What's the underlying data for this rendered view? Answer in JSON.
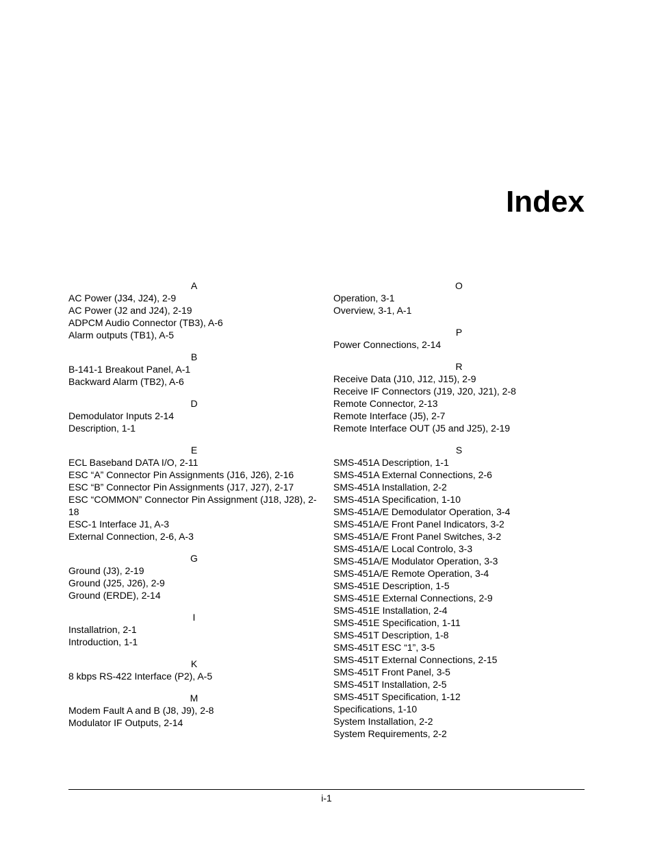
{
  "title": "Index",
  "page_label": "i-1",
  "columns": [
    {
      "groups": [
        {
          "letter": "A",
          "entries": [
            "AC Power (J34, J24), 2-9",
            "AC Power (J2 and J24), 2-19",
            "ADPCM Audio Connector (TB3), A-6",
            "Alarm outputs (TB1), A-5"
          ]
        },
        {
          "letter": "B",
          "entries": [
            "B-141-1 Breakout Panel, A-1",
            "Backward Alarm (TB2), A-6"
          ]
        },
        {
          "letter": "D",
          "entries": [
            "Demodulator Inputs 2-14",
            "Description, 1-1"
          ]
        },
        {
          "letter": "E",
          "entries": [
            "ECL Baseband DATA I/O, 2-11",
            "ESC “A” Connector Pin Assignments (J16, J26), 2-16",
            "ESC “B” Connector Pin Assignments (J17, J27), 2-17",
            "ESC “COMMON” Connector Pin Assignment (J18, J28), 2-18",
            "ESC-1 Interface J1, A-3",
            "External Connection, 2-6, A-3"
          ]
        },
        {
          "letter": "G",
          "entries": [
            "Ground (J3), 2-19",
            "Ground (J25, J26), 2-9",
            "Ground (ERDE), 2-14"
          ]
        },
        {
          "letter": "I",
          "entries": [
            "Installatrion, 2-1",
            "Introduction, 1-1"
          ]
        },
        {
          "letter": "K",
          "entries": [
            "8 kbps RS-422 Interface (P2), A-5"
          ]
        },
        {
          "letter": "M",
          "entries": [
            "Modem Fault A and B (J8, J9), 2-8",
            "Modulator IF Outputs, 2-14"
          ]
        }
      ]
    },
    {
      "groups": [
        {
          "letter": "O",
          "entries": [
            "Operation, 3-1",
            "Overview, 3-1, A-1"
          ]
        },
        {
          "letter": "P",
          "entries": [
            "Power Connections, 2-14"
          ]
        },
        {
          "letter": "R",
          "entries": [
            "Receive Data (J10, J12, J15), 2-9",
            "Receive IF Connectors (J19, J20, J21), 2-8",
            "Remote Connector, 2-13",
            "Remote Interface (J5), 2-7",
            "Remote Interface OUT (J5 and J25), 2-19"
          ]
        },
        {
          "letter": "S",
          "entries": [
            "SMS-451A Description, 1-1",
            "SMS-451A External Connections, 2-6",
            "SMS-451A Installation, 2-2",
            "SMS-451A Specification, 1-10",
            "SMS-451A/E Demodulator Operation, 3-4",
            "SMS-451A/E Front Panel Indicators, 3-2",
            "SMS-451A/E Front Panel Switches, 3-2",
            "SMS-451A/E Local Controlo, 3-3",
            "SMS-451A/E Modulator Operation, 3-3",
            "SMS-451A/E Remote Operation, 3-4",
            "SMS-451E Description, 1-5",
            "SMS-451E External Connections, 2-9",
            "SMS-451E Installation, 2-4",
            "SMS-451E Specification, 1-11",
            "SMS-451T Description, 1-8",
            "SMS-451T ESC “1”, 3-5",
            "SMS-451T External Connections, 2-15",
            "SMS-451T Front Panel, 3-5",
            "SMS-451T Installation, 2-5",
            "SMS-451T Specification, 1-12",
            "Specifications, 1-10",
            "System Installation, 2-2",
            "System Requirements, 2-2"
          ]
        }
      ]
    }
  ]
}
